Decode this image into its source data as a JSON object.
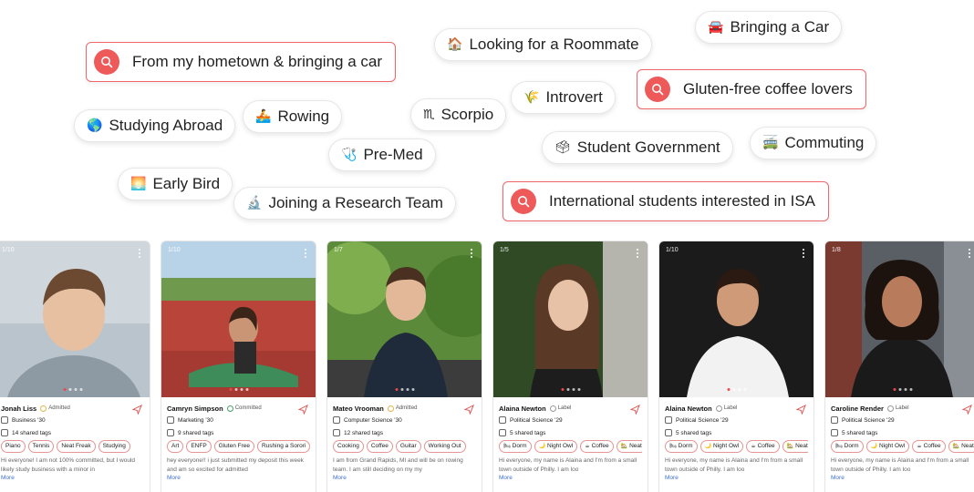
{
  "searches": [
    {
      "text": "From my hometown & bringing a car"
    },
    {
      "text": "Gluten-free coffee lovers"
    },
    {
      "text": "International students interested in ISA"
    }
  ],
  "pills": [
    {
      "emoji": "🚘",
      "text": "Bringing a Car"
    },
    {
      "emoji": "🏠",
      "text": "Looking for a Roommate"
    },
    {
      "emoji": "🌎",
      "text": "Studying Abroad"
    },
    {
      "emoji": "🚣",
      "text": "Rowing"
    },
    {
      "emoji": "♏",
      "text": "Scorpio"
    },
    {
      "emoji": "🌾",
      "text": "Introvert"
    },
    {
      "emoji": "🩺",
      "text": "Pre-Med"
    },
    {
      "emoji": "🗳",
      "text": "Student Government"
    },
    {
      "emoji": "🚎",
      "text": "Commuting"
    },
    {
      "emoji": "🌅",
      "text": "Early Bird"
    },
    {
      "emoji": "🔬",
      "text": "Joining a Research Team"
    }
  ],
  "icons": {
    "search": "search-icon",
    "send": "send-icon",
    "more": "more-icon",
    "badge": "badge-icon",
    "major": "graduation-cap-icon",
    "tags": "tags-icon"
  },
  "colors": {
    "accent": "#ee5a5a",
    "search_border": "#f0666a",
    "link": "#3b6fd6",
    "tag_border": "#e79494"
  },
  "cards": [
    {
      "counter": "1/10",
      "name": "Jonah Liss",
      "status": "Admitted",
      "major": "Business '30",
      "shared": "14 shared tags",
      "tags": [
        {
          "e": "",
          "t": "Piano"
        },
        {
          "e": "",
          "t": "Tennis"
        },
        {
          "e": "",
          "t": "Neat Freak"
        },
        {
          "e": "",
          "t": "Studying"
        }
      ],
      "bio": "Hi everyone! I am not 100% committed, but I would likely study business with a minor in",
      "more": "More"
    },
    {
      "counter": "1/10",
      "name": "Camryn Simpson",
      "status": "Committed",
      "major": "Marketing '30",
      "shared": "9 shared tags",
      "tags": [
        {
          "e": "",
          "t": "Art"
        },
        {
          "e": "",
          "t": "ENFP"
        },
        {
          "e": "",
          "t": "Gluten Free"
        },
        {
          "e": "",
          "t": "Rushing a Sorori"
        }
      ],
      "bio": "hey everyone!! i just submitted my deposit this week and am so excited for admitted",
      "more": "More"
    },
    {
      "counter": "1/7",
      "name": "Mateo Vrooman",
      "status": "Admitted",
      "major": "Computer Science '30",
      "shared": "12 shared tags",
      "tags": [
        {
          "e": "",
          "t": "Cooking"
        },
        {
          "e": "",
          "t": "Coffee"
        },
        {
          "e": "",
          "t": "Guitar"
        },
        {
          "e": "",
          "t": "Working Out"
        }
      ],
      "bio": "I am from Grand Rapids, MI and will be on rowing team. I am still deciding on my my",
      "more": "More"
    },
    {
      "counter": "1/5",
      "name": "Alaina Newton",
      "status": "Label",
      "major": "Political Science '29",
      "shared": "5 shared tags",
      "tags": [
        {
          "e": "🛏",
          "t": "Dorm"
        },
        {
          "e": "🌙",
          "t": "Night Owl"
        },
        {
          "e": "☕",
          "t": "Coffee"
        },
        {
          "e": "🏡",
          "t": "Neat"
        }
      ],
      "bio": "Hi everyone, my name is Alaina and I'm from a small town outside of Philly. I am loo",
      "more": "More"
    },
    {
      "counter": "1/10",
      "name": "Alaina Newton",
      "status": "Label",
      "major": "Political Science '29",
      "shared": "5 shared tags",
      "tags": [
        {
          "e": "🛏",
          "t": "Dorm"
        },
        {
          "e": "🌙",
          "t": "Night Owl"
        },
        {
          "e": "☕",
          "t": "Coffee"
        },
        {
          "e": "🏡",
          "t": "Neat"
        }
      ],
      "bio": "Hi everyone, my name is Alaina and I'm from a small town outside of Philly. I am loo",
      "more": "More"
    },
    {
      "counter": "1/8",
      "name": "Caroline Render",
      "status": "Label",
      "major": "Political Science '29",
      "shared": "5 shared tags",
      "tags": [
        {
          "e": "🛏",
          "t": "Dorm"
        },
        {
          "e": "🌙",
          "t": "Night Owl"
        },
        {
          "e": "☕",
          "t": "Coffee"
        },
        {
          "e": "🏡",
          "t": "Neat"
        }
      ],
      "bio": "Hi everyone, my name is Alaina and I'm from a small town outside of Philly. I am loo",
      "more": "More"
    }
  ]
}
